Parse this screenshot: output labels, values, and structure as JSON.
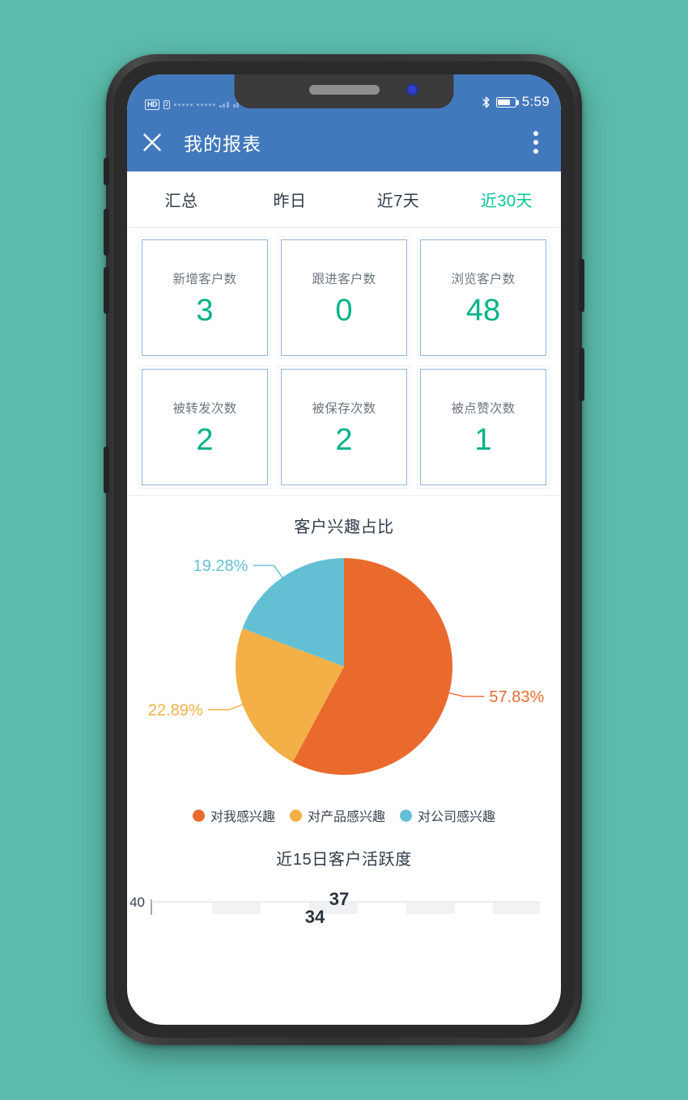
{
  "status_bar": {
    "network_badge": "HD",
    "network_badge_sub": "2",
    "clock": "5:59",
    "bluetooth_icon": "bluetooth-icon",
    "battery_icon": "battery-icon"
  },
  "app_bar": {
    "close_icon": "close-icon",
    "title": "我的报表",
    "more_icon": "overflow-menu-icon"
  },
  "tabs": [
    {
      "label": "汇总",
      "active": false
    },
    {
      "label": "昨日",
      "active": false
    },
    {
      "label": "近7天",
      "active": false
    },
    {
      "label": "近30天",
      "active": true
    }
  ],
  "stats": [
    {
      "label": "新增客户数",
      "value": "3"
    },
    {
      "label": "跟进客户数",
      "value": "0"
    },
    {
      "label": "浏览客户数",
      "value": "48"
    },
    {
      "label": "被转发次数",
      "value": "2"
    },
    {
      "label": "被保存次数",
      "value": "2"
    },
    {
      "label": "被点赞次数",
      "value": "1"
    }
  ],
  "colors": {
    "background_teal": "#5BBCAB",
    "header_blue": "#4279BD",
    "accent_teal": "#00B286",
    "tab_active": "#00C79A",
    "pie_orange": "#EA6A2E",
    "pie_yellow": "#F2B046",
    "pie_cyan": "#63C0D4",
    "card_border": "#93b4d8"
  },
  "chart_data": [
    {
      "type": "pie",
      "title": "客户兴趣占比",
      "labels": [
        "对我感兴趣",
        "对产品感兴趣",
        "对公司感兴趣"
      ],
      "values": [
        57.83,
        22.89,
        19.28
      ],
      "value_labels": [
        "57.83%",
        "22.89%",
        "19.28%"
      ],
      "colors": [
        "#EA6A2E",
        "#F2B046",
        "#63C0D4"
      ],
      "legend_position": "bottom",
      "start_angle_deg": 0,
      "direction": "clockwise"
    },
    {
      "type": "bar",
      "title": "近15日客户活跃度",
      "note": "chart is cut off at bottom edge of screenshot",
      "ylabel": "",
      "xlabel": "",
      "ylim": [
        0,
        40
      ],
      "y_ticks": [
        "40"
      ],
      "visible_data_labels": [
        "37",
        "34"
      ],
      "grid": true
    }
  ]
}
